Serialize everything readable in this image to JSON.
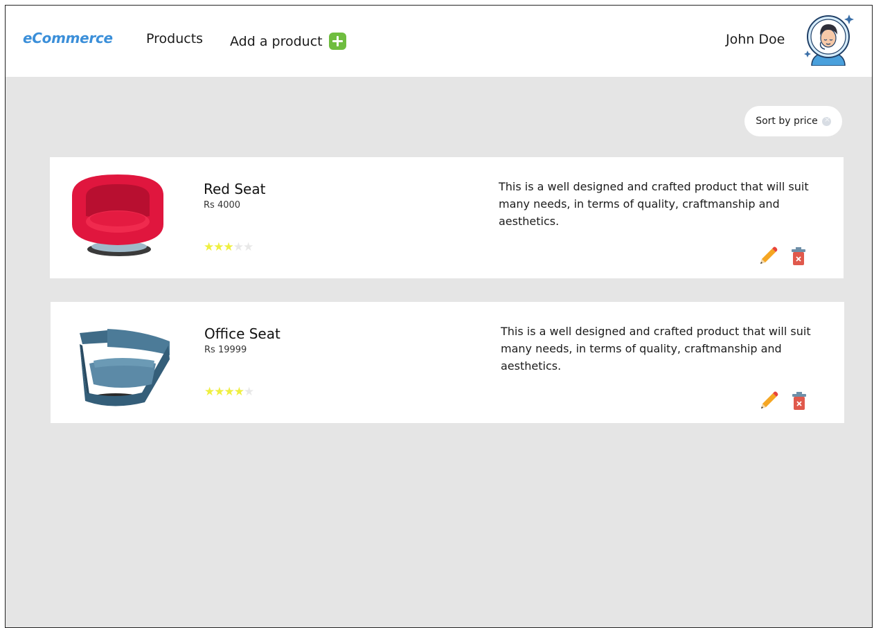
{
  "nav": {
    "brand": "eCommerce",
    "products_label": "Products",
    "add_product_label": "Add a product",
    "user_name": "John Doe"
  },
  "toolbar": {
    "sort_label": "Sort by price"
  },
  "products": [
    {
      "name": "Red Seat",
      "price": "Rs 4000",
      "rating": 3,
      "max_rating": 5,
      "description": "This is a well designed and crafted product that will suit many needs, in terms of quality, craftmanship and aesthetics.",
      "image_icon": "red-armchair-icon"
    },
    {
      "name": "Office Seat",
      "price": "Rs 19999",
      "rating": 4,
      "max_rating": 5,
      "description": "This is a well designed and crafted product that will suit many needs, in terms of quality, craftmanship and aesthetics.",
      "image_icon": "blue-armchair-icon"
    }
  ],
  "colors": {
    "brand": "#3b8fd9",
    "add_icon": "#6fbd3f",
    "star_on": "#efef40",
    "star_off": "#e8e8e8",
    "background": "#e5e5e5",
    "delete_icon": "#e0594c",
    "edit_icon": "#f5a623"
  }
}
